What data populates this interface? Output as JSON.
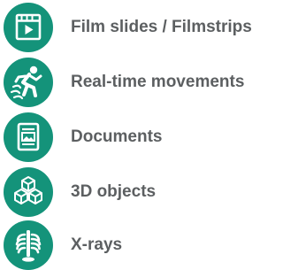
{
  "colors": {
    "accent": "#14937a",
    "text": "#5c5f61",
    "icon": "#ffffff"
  },
  "items": [
    {
      "label": "Film slides / Filmstrips",
      "icon": "film-slide-icon"
    },
    {
      "label": "Real-time movements",
      "icon": "running-figure-icon"
    },
    {
      "label": "Documents",
      "icon": "document-icon"
    },
    {
      "label": "3D objects",
      "icon": "cubes-3d-icon"
    },
    {
      "label": "X-rays",
      "icon": "xray-ribcage-icon"
    }
  ]
}
